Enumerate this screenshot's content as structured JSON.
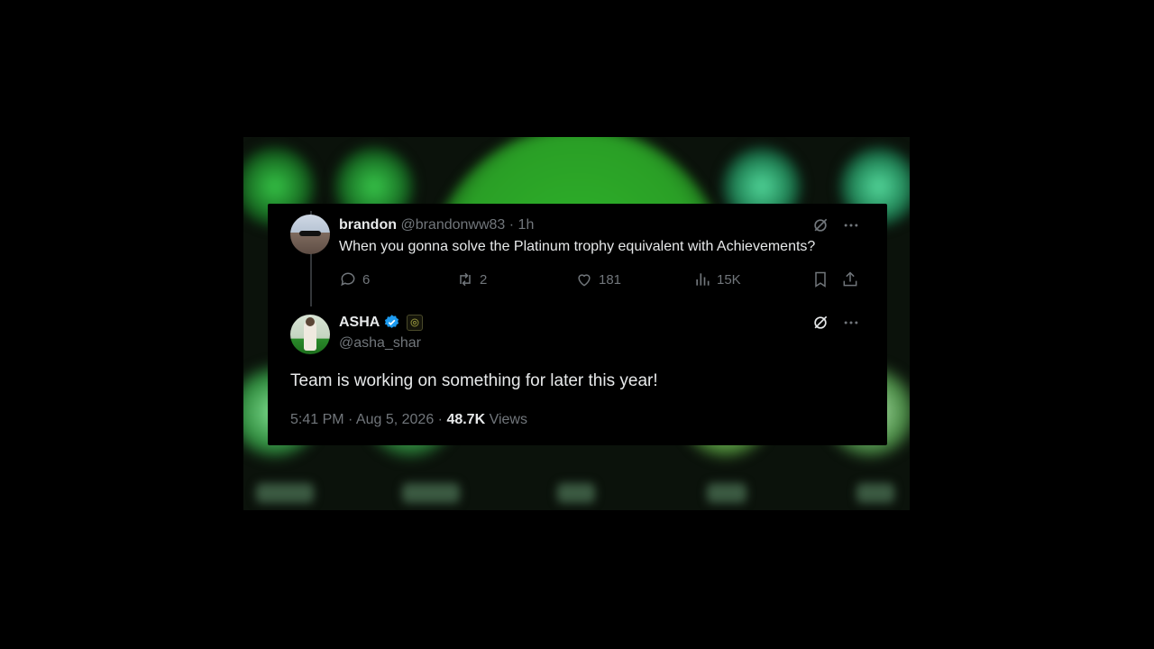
{
  "reply_tweet": {
    "display_name": "brandon",
    "handle": "@brandonww83",
    "time": "· 1h",
    "text": "When you gonna solve the Platinum trophy equivalent with Achievements?",
    "stats": {
      "replies": "6",
      "retweets": "2",
      "likes": "181",
      "views": "15K"
    }
  },
  "main_tweet": {
    "display_name": "ASHA",
    "handle": "@asha_shar",
    "text": "Team is working on something for later this year!",
    "timestamp": "5:41 PM · Aug 5, 2026 · ",
    "views_count": "48.7K",
    "views_label": " Views"
  },
  "icons": {
    "verified_color": "#1d9bf0",
    "muted_color": "#71767b"
  }
}
